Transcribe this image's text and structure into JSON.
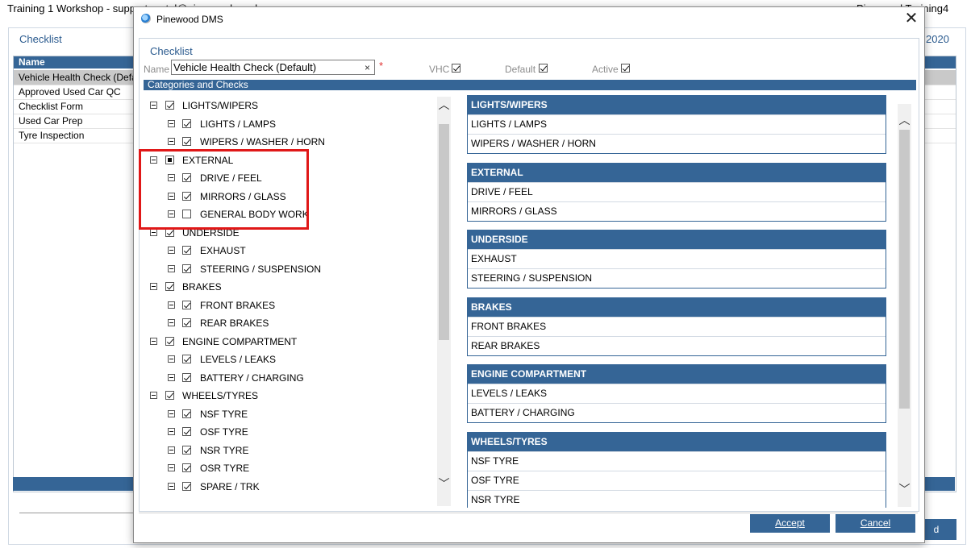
{
  "background": {
    "window_title": "Training 1 Workshop - support.portal@pinewood.co.uk",
    "user_name": "Pinewood Training4",
    "heading": "Checklist",
    "year_fragment": "2020",
    "list_header": "Name",
    "rows": [
      "Vehicle Health Check (Default)",
      "Approved Used Car QC",
      "Checklist Form",
      "Used Car Prep",
      "Tyre Inspection"
    ],
    "button_fragment": "d"
  },
  "dialog": {
    "title": "Pinewood DMS",
    "close_glyph": "✕",
    "heading": "Checklist",
    "name_label": "Name",
    "name_value": "Vehicle Health Check (Default)",
    "clear_glyph": "×",
    "required_mark": "*",
    "flags": [
      {
        "label": "VHC",
        "checked": true
      },
      {
        "label": "Default",
        "checked": true
      },
      {
        "label": "Active",
        "checked": true
      }
    ],
    "section_title": "Categories and Checks",
    "tree": [
      {
        "label": "LIGHTS/WIPERS",
        "state": "checked",
        "children": [
          {
            "label": "LIGHTS / LAMPS",
            "checked": true
          },
          {
            "label": "WIPERS / WASHER / HORN",
            "checked": true
          }
        ]
      },
      {
        "label": "EXTERNAL",
        "state": "partial",
        "children": [
          {
            "label": "DRIVE / FEEL",
            "checked": true
          },
          {
            "label": "MIRRORS / GLASS",
            "checked": true
          },
          {
            "label": "GENERAL BODY WORK",
            "checked": false
          }
        ]
      },
      {
        "label": "UNDERSIDE",
        "state": "checked",
        "children": [
          {
            "label": "EXHAUST",
            "checked": true
          },
          {
            "label": "STEERING / SUSPENSION",
            "checked": true
          }
        ]
      },
      {
        "label": "BRAKES",
        "state": "checked",
        "children": [
          {
            "label": "FRONT BRAKES",
            "checked": true
          },
          {
            "label": "REAR BRAKES",
            "checked": true
          }
        ]
      },
      {
        "label": "ENGINE COMPARTMENT",
        "state": "checked",
        "children": [
          {
            "label": "LEVELS / LEAKS",
            "checked": true
          },
          {
            "label": "BATTERY / CHARGING",
            "checked": true
          }
        ]
      },
      {
        "label": "WHEELS/TYRES",
        "state": "checked",
        "children": [
          {
            "label": "NSF TYRE",
            "checked": true
          },
          {
            "label": "OSF TYRE",
            "checked": true
          },
          {
            "label": "NSR TYRE",
            "checked": true
          },
          {
            "label": "OSR TYRE",
            "checked": true
          },
          {
            "label": "SPARE / TRK",
            "checked": true
          }
        ]
      }
    ],
    "categories": [
      {
        "title": "LIGHTS/WIPERS",
        "items": [
          "LIGHTS / LAMPS",
          "WIPERS / WASHER / HORN"
        ]
      },
      {
        "title": "EXTERNAL",
        "items": [
          "DRIVE / FEEL",
          "MIRRORS / GLASS"
        ]
      },
      {
        "title": "UNDERSIDE",
        "items": [
          "EXHAUST",
          "STEERING / SUSPENSION"
        ]
      },
      {
        "title": "BRAKES",
        "items": [
          "FRONT BRAKES",
          "REAR BRAKES"
        ]
      },
      {
        "title": "ENGINE COMPARTMENT",
        "items": [
          "LEVELS / LEAKS",
          "BATTERY / CHARGING"
        ]
      },
      {
        "title": "WHEELS/TYRES",
        "items": [
          "NSF TYRE",
          "OSF TYRE",
          "NSR TYRE"
        ]
      }
    ],
    "accept_label": "Accept",
    "cancel_label": "Cancel",
    "scroll_up_glyph": "︿",
    "scroll_down_glyph": "﹀"
  }
}
